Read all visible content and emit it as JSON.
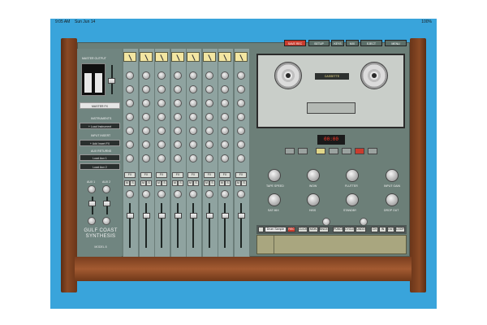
{
  "status": {
    "time": "9:05 AM",
    "date": "Sun Jun 14",
    "battery": "100%"
  },
  "top_buttons": [
    "SAVE REC",
    "SETUP",
    "KEYS",
    "MIX",
    "EJECT",
    "MENU"
  ],
  "master": {
    "title": "MASTER OUTPUT",
    "fx_button": "MASTER FX",
    "instruments_label": "INSTRUMENTS",
    "load_instrument": "+ Load Instrument",
    "input_insert_label": "INPUT INSERT",
    "add_insert": "+ Add Insert FX",
    "aux_returns_label": "AUX RETURNS",
    "aux1": "Load Aux 1",
    "aux2": "Load Aux 2",
    "aux_knob_labels": [
      "AUX 1",
      "AUX 2"
    ]
  },
  "channels": {
    "count": 8,
    "fx_label": "FX",
    "mute_label": "M",
    "solo_label": "S"
  },
  "tape": {
    "cassette_label": "CASSETTE",
    "counter": "00:00",
    "knobs_row1": [
      "TAPE SPEED",
      "WOW",
      "FLUTTER",
      "INPUT GAIN"
    ],
    "knobs_row2": [
      "SAT MIX",
      "HISS",
      "STANDBY",
      "DROP OUT"
    ]
  },
  "sampler": {
    "name": "Drum Sample",
    "rec": "REC",
    "buttons": [
      "CLICK",
      "MON",
      "BNCE",
      "PUNCH",
      "CYCLE",
      "UNDO"
    ],
    "small_buttons": [
      "CH",
      "IN",
      "OUT",
      "LOOP"
    ]
  },
  "brand": {
    "line1": "GULF COAST",
    "line2": "SYNTHESIS",
    "model": "MODEL 8"
  },
  "colors": {
    "frame": "#39a4db",
    "panel": "#6c7f78",
    "wood": "#8a4a25",
    "vu": "#f3e6a2",
    "rec": "#c93c2e"
  }
}
